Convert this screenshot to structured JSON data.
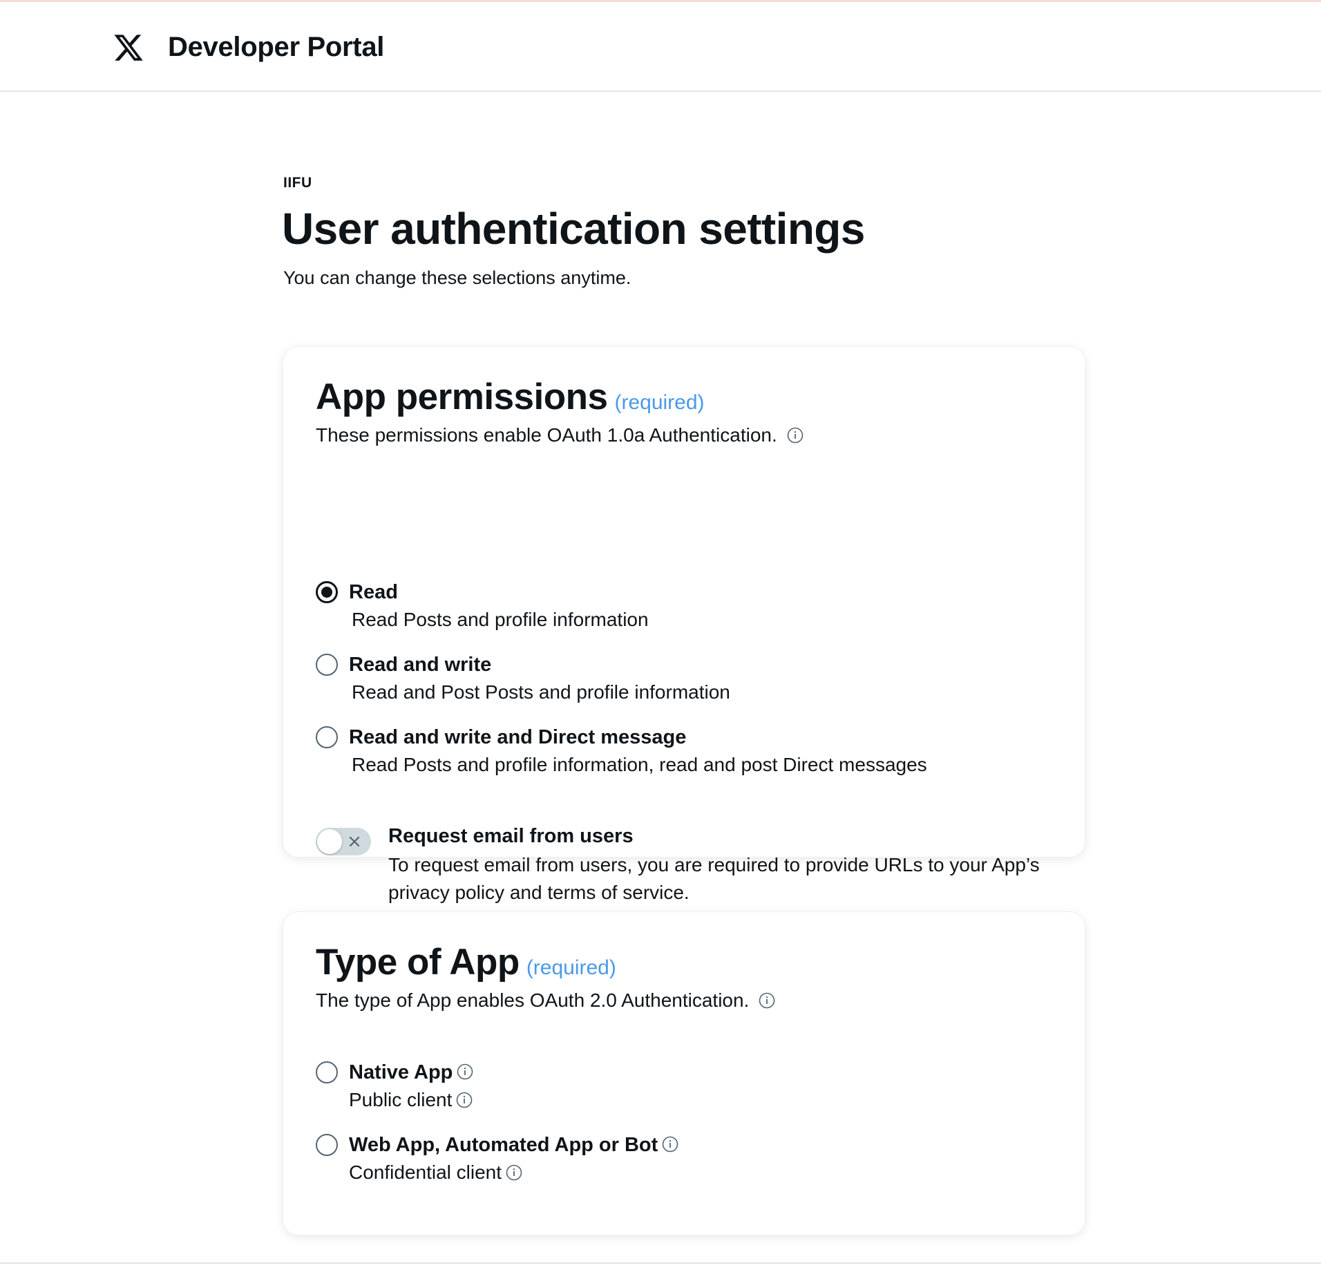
{
  "header": {
    "logo_icon": "x-logo-icon",
    "brand": "Developer Portal"
  },
  "page": {
    "eyebrow": "IIFU",
    "title": "User authentication settings",
    "subtitle": "You can change these selections anytime."
  },
  "permissions": {
    "heading": "App permissions",
    "required": "(required)",
    "description": "These permissions enable OAuth 1.0a Authentication.",
    "options": [
      {
        "label": "Read",
        "description": "Read Posts and profile information",
        "selected": true
      },
      {
        "label": "Read and write",
        "description": "Read and Post Posts and profile information",
        "selected": false
      },
      {
        "label": "Read and write and Direct message",
        "description": "Read Posts and profile information, read and post Direct messages",
        "selected": false
      }
    ],
    "email_toggle": {
      "label": "Request email from users",
      "description": "To request email from users, you are required to provide URLs to your App’s privacy policy and terms of service.",
      "enabled": false
    }
  },
  "app_type": {
    "heading": "Type of App",
    "required": "(required)",
    "description": "The type of App enables OAuth 2.0 Authentication.",
    "options": [
      {
        "label": "Native App",
        "description": "Public client",
        "selected": false
      },
      {
        "label": "Web App, Automated App or Bot",
        "description": "Confidential client",
        "selected": false
      }
    ]
  },
  "colors": {
    "accent_required": "#4a99e9",
    "text": "#0f1419",
    "toggle_off": "#cfd9de"
  }
}
